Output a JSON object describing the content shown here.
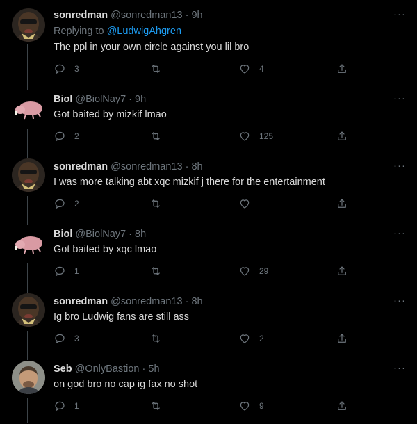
{
  "tweets": [
    {
      "name": "sonredman",
      "handle": "@sonredman13",
      "time": "9h",
      "replying_prefix": "Replying to ",
      "replying_to": "@LudwigAhgren",
      "text": "The ppl in your own circle against you lil bro",
      "replies": "3",
      "retweets": "",
      "likes": "4",
      "avatar": "sonredman-avatar"
    },
    {
      "name": "Biol",
      "handle": "@BiolNay7",
      "time": "9h",
      "text": "Got baited by mizkif lmao",
      "replies": "2",
      "retweets": "",
      "likes": "125",
      "avatar": "mole-rat-avatar"
    },
    {
      "name": "sonredman",
      "handle": "@sonredman13",
      "time": "8h",
      "text": "I was more talking abt xqc mizkif j there for the entertainment",
      "replies": "2",
      "retweets": "",
      "likes": "",
      "avatar": "sonredman-avatar"
    },
    {
      "name": "Biol",
      "handle": "@BiolNay7",
      "time": "8h",
      "text": "Got baited by xqc lmao",
      "replies": "1",
      "retweets": "",
      "likes": "29",
      "avatar": "mole-rat-avatar"
    },
    {
      "name": "sonredman",
      "handle": "@sonredman13",
      "time": "8h",
      "text": "Ig bro Ludwig fans are still ass",
      "replies": "3",
      "retweets": "",
      "likes": "2",
      "avatar": "sonredman-avatar"
    },
    {
      "name": "Seb",
      "handle": "@OnlyBastion",
      "time": "5h",
      "text": "on god bro no cap ig fax no shot",
      "replies": "1",
      "retweets": "",
      "likes": "9",
      "avatar": "seb-avatar"
    }
  ],
  "ui": {
    "more_glyph": "···",
    "separator": " · ",
    "icons": [
      "reply-icon",
      "retweet-icon",
      "like-icon",
      "share-icon"
    ],
    "colors": {
      "background": "#000000",
      "text": "#d9d9d9",
      "muted": "#6e767d",
      "link": "#1d9bf0",
      "thread_line": "#3d4449"
    }
  }
}
